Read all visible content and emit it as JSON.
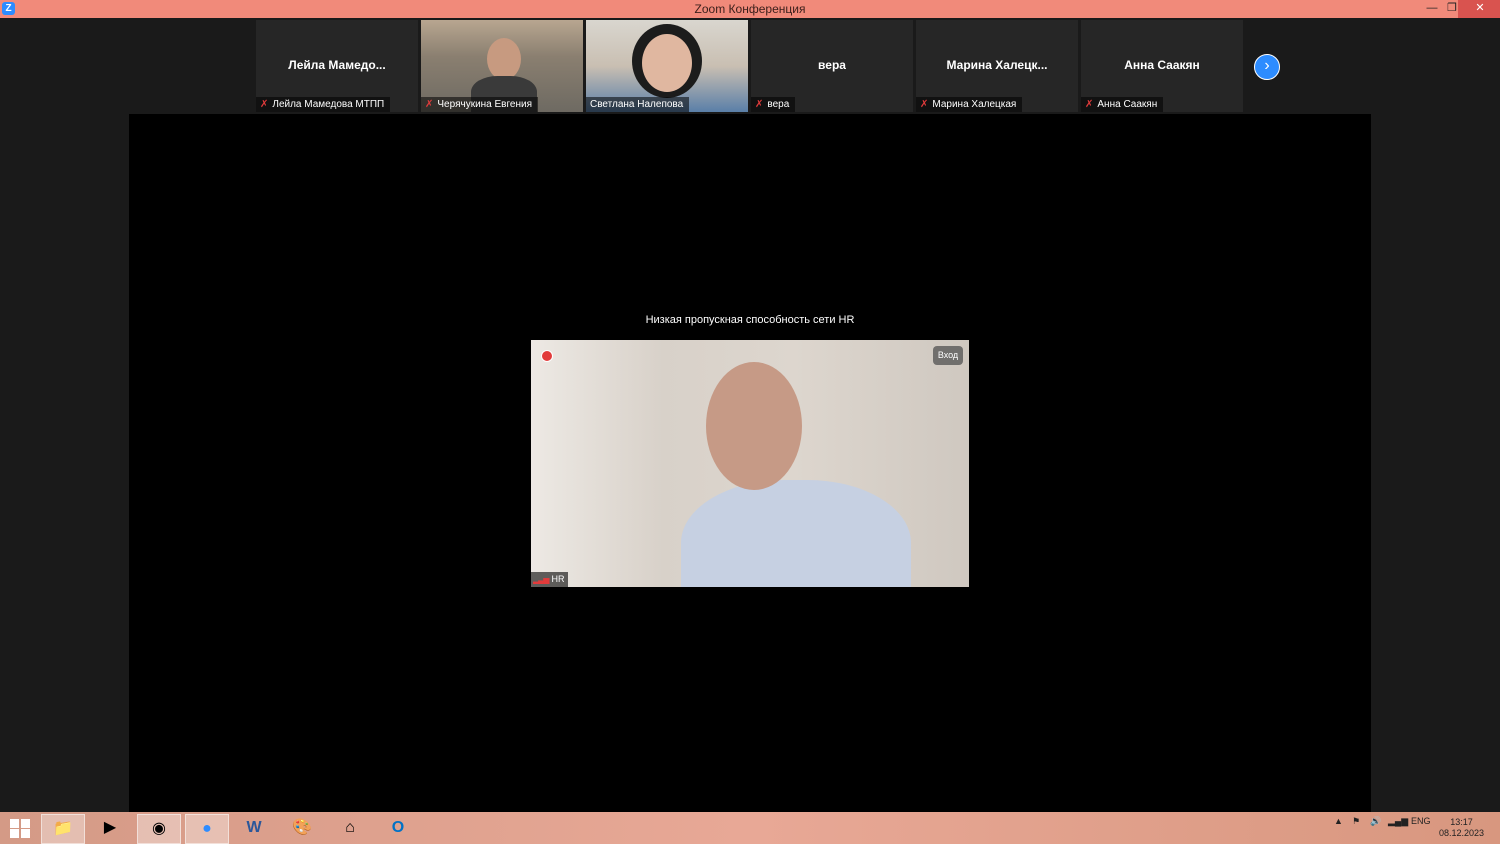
{
  "window": {
    "title": "Zoom Конференция"
  },
  "participants": [
    {
      "name": "Лейла  Мамедо...",
      "caption": "Лейла Мамедова МТПП"
    },
    {
      "name": "",
      "caption": "Черячукина Евгения"
    },
    {
      "name": "",
      "caption": "Светлана Налепова"
    },
    {
      "name": "вера",
      "caption": "вера"
    },
    {
      "name": "Марина  Халецк...",
      "caption": "Марина Халецкая"
    },
    {
      "name": "Анна Саакян",
      "caption": "Анна Саакян"
    }
  ],
  "main": {
    "network_message": "Низкая пропускная способность сети HR",
    "join_label": "Вход",
    "speaker_label": "HR"
  },
  "colors": {
    "titlebar": "#f18a7a",
    "accent": "#2d8cff",
    "mic_muted": "#e23b3b"
  },
  "taskbar": {
    "language": "ENG",
    "time": "13:17",
    "date": "08.12.2023"
  }
}
